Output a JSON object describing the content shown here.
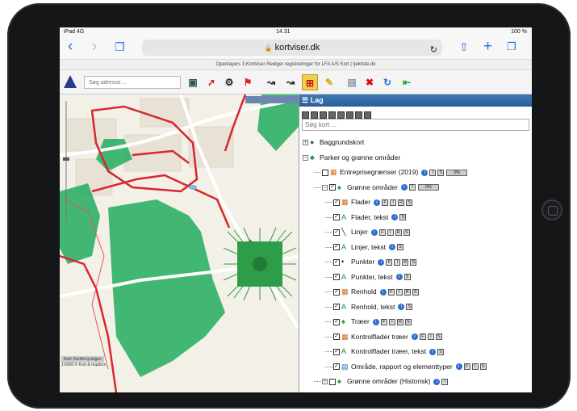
{
  "status": {
    "left": "iPad 4G",
    "time": "14.31",
    "battery": "100 %"
  },
  "browser": {
    "url": "kortviser.dk",
    "tab_text": "Openlayers 3 Kortviser Rediger registreringer for LFA A/S    Kort | tjekliste.dk"
  },
  "toolbar": {
    "search_placeholder": "Søg adresse ...",
    "tools": [
      "layers",
      "pointer",
      "gear",
      "flag",
      "measure-line",
      "measure-area",
      "select",
      "edit",
      "print",
      "delete",
      "refresh",
      "exit"
    ]
  },
  "map": {
    "attribution_pill": "Kort: Kortforsyningen",
    "scale": "1:6000  © Kort & mapbox"
  },
  "panel": {
    "title": "Lag",
    "search_placeholder": "Søg kort ...",
    "layers": [
      {
        "indent": 0,
        "label": "Baggrundskort",
        "expander": "+",
        "icon": "globe-icon"
      },
      {
        "indent": 0,
        "label": "Parker og grønne områder",
        "expander": "-",
        "icon": "park-icon"
      },
      {
        "indent": 1,
        "label": "Entreprisegrænser (2019)",
        "checked": false,
        "icon": "grid-icon",
        "buttons": [
          "I",
          "S"
        ],
        "pct": "0%"
      },
      {
        "indent": 1,
        "label": "Grønne områder",
        "expander": "-",
        "checked": true,
        "icon": "tree-icon",
        "buttons": [
          "I"
        ],
        "pct": "0%"
      },
      {
        "indent": 2,
        "label": "Flader",
        "checked": true,
        "icon": "grid-icon",
        "buttons": [
          "F",
          "I",
          "R",
          "S"
        ]
      },
      {
        "indent": 2,
        "label": "Flader, tekst",
        "checked": true,
        "icon": "text-icon",
        "buttons": [
          "S"
        ]
      },
      {
        "indent": 2,
        "label": "Linjer",
        "checked": true,
        "icon": "line-icon",
        "buttons": [
          "F",
          "I",
          "R",
          "S"
        ]
      },
      {
        "indent": 2,
        "label": "Linjer, tekst",
        "checked": true,
        "icon": "text-icon",
        "buttons": [
          "S"
        ]
      },
      {
        "indent": 2,
        "label": "Punkter",
        "checked": true,
        "icon": "point-icon",
        "buttons": [
          "F",
          "I",
          "R",
          "S"
        ]
      },
      {
        "indent": 2,
        "label": "Punkter, tekst",
        "checked": true,
        "icon": "text-icon",
        "buttons": [
          "S"
        ]
      },
      {
        "indent": 2,
        "label": "Renhold",
        "checked": true,
        "icon": "grid-icon",
        "buttons": [
          "F",
          "I",
          "R",
          "S"
        ]
      },
      {
        "indent": 2,
        "label": "Renhold, tekst",
        "checked": true,
        "icon": "text-icon",
        "buttons": [
          "S"
        ]
      },
      {
        "indent": 2,
        "label": "Træer",
        "checked": true,
        "icon": "tree-icon",
        "buttons": [
          "F",
          "I",
          "R",
          "S"
        ]
      },
      {
        "indent": 2,
        "label": "Kontrolflader træer",
        "checked": true,
        "icon": "grid-icon",
        "buttons": [
          "F",
          "I",
          "S"
        ]
      },
      {
        "indent": 2,
        "label": "Kontrolflader træer, tekst",
        "checked": true,
        "icon": "text-icon",
        "buttons": [
          "S"
        ]
      },
      {
        "indent": 2,
        "label": "Område, rapport og elementtyper",
        "checked": true,
        "icon": "table-icon",
        "buttons": [
          "F",
          "I",
          "S"
        ]
      },
      {
        "indent": 1,
        "label": "Grønne områder (Historisk)",
        "expander": "+",
        "checked": false,
        "icon": "tree-icon",
        "buttons": [
          "I"
        ]
      }
    ]
  }
}
